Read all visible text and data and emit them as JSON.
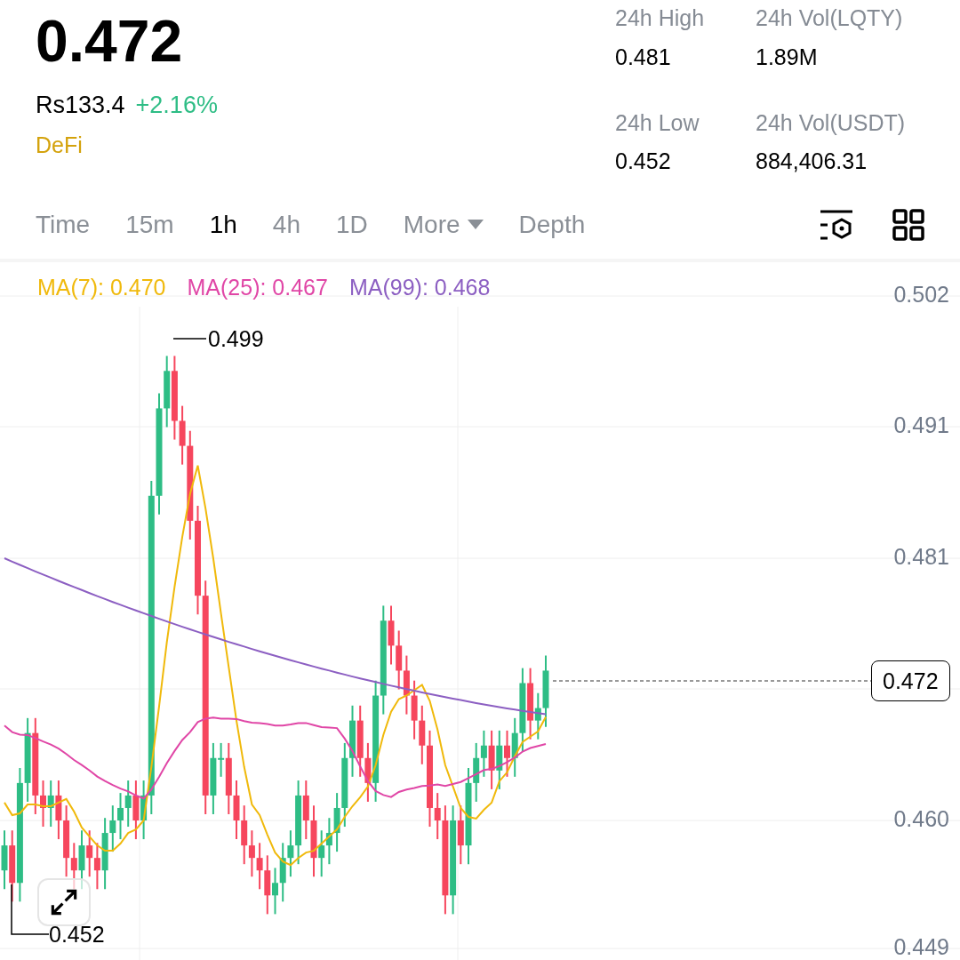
{
  "price": "0.472",
  "fiat_price": "Rs133.4",
  "change": "+2.16%",
  "tag": "DeFi",
  "stats": [
    {
      "label": "24h High",
      "value": "0.481"
    },
    {
      "label": "24h Vol(LQTY)",
      "value": "1.89M"
    },
    {
      "label": "24h Low",
      "value": "0.452"
    },
    {
      "label": "24h Vol(USDT)",
      "value": "884,406.31"
    }
  ],
  "intervals": [
    {
      "label": "Time",
      "kind": "tab",
      "selected": false
    },
    {
      "label": "15m",
      "kind": "tab",
      "selected": false
    },
    {
      "label": "1h",
      "kind": "tab",
      "selected": true
    },
    {
      "label": "4h",
      "kind": "tab",
      "selected": false
    },
    {
      "label": "1D",
      "kind": "tab",
      "selected": false
    },
    {
      "label": "More",
      "kind": "dropdown",
      "selected": false
    },
    {
      "label": "Depth",
      "kind": "tab",
      "selected": false
    }
  ],
  "chart": {
    "moving_averages": [
      {
        "label": "MA(7): 0.470",
        "color": "#f0b90b"
      },
      {
        "label": "MA(25): 0.467",
        "color": "#e046a6"
      },
      {
        "label": "MA(99): 0.468",
        "color": "#8c5fc2"
      }
    ],
    "price_axis": [
      "0.502",
      "0.491",
      "0.481",
      "0.460",
      "0.449"
    ],
    "high_marker": "0.499",
    "low_marker": "0.452",
    "last_price": "0.472"
  }
}
